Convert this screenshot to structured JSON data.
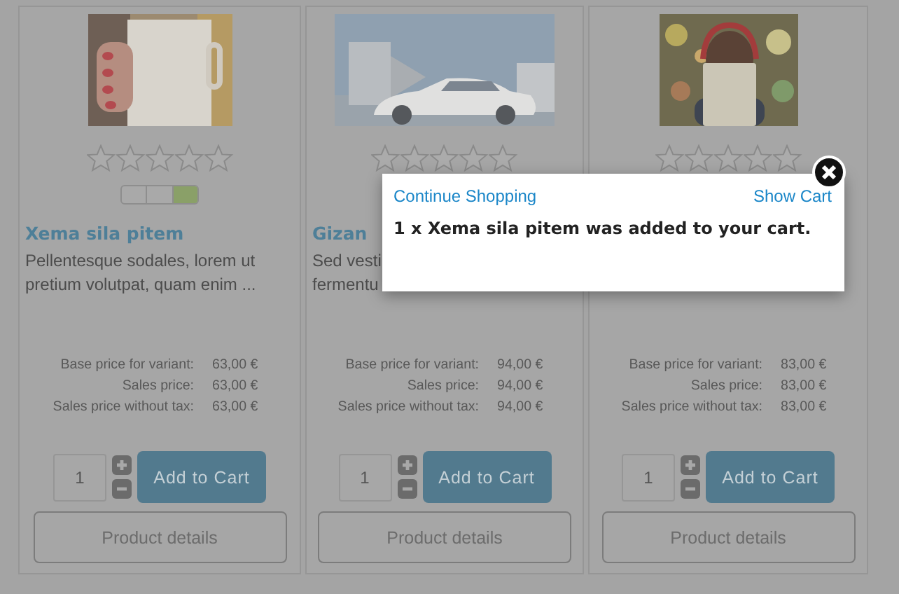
{
  "products": [
    {
      "stars": 0,
      "availability": {
        "kind": "high"
      },
      "title": "Xema sila pitem",
      "description": [
        "Pellentesque sodales, lorem ut",
        "pretium volutpat, quam enim ..."
      ],
      "prices": [
        {
          "label": "Base price for variant:",
          "value": "63,00 €"
        },
        {
          "label": "Sales price:",
          "value": "63,00 €"
        },
        {
          "label": "Sales price without tax:",
          "value": "63,00 €"
        }
      ],
      "quantity": "1",
      "add_button": "Add to Cart",
      "details_button": "Product details"
    },
    {
      "stars": 0,
      "title": "Gizan",
      "description": [
        "Sed vesti",
        "fermentu"
      ],
      "prices": [
        {
          "label": "Base price for variant:",
          "value": "94,00 €"
        },
        {
          "label": "Sales price:",
          "value": "94,00 €"
        },
        {
          "label": "Sales price without tax:",
          "value": "94,00 €"
        }
      ],
      "quantity": "1",
      "add_button": "Add to Cart",
      "details_button": "Product details"
    },
    {
      "stars": 0,
      "prices": [
        {
          "label": "Base price for variant:",
          "value": "83,00 €"
        },
        {
          "label": "Sales price:",
          "value": "83,00 €"
        },
        {
          "label": "Sales price without tax:",
          "value": "83,00 €"
        }
      ],
      "quantity": "1",
      "add_button": "Add to Cart",
      "details_button": "Product details"
    }
  ],
  "popup": {
    "continue_link": "Continue Shopping",
    "cart_link": "Show Cart",
    "message": "1 x Xema sila pitem was added to your cart."
  }
}
